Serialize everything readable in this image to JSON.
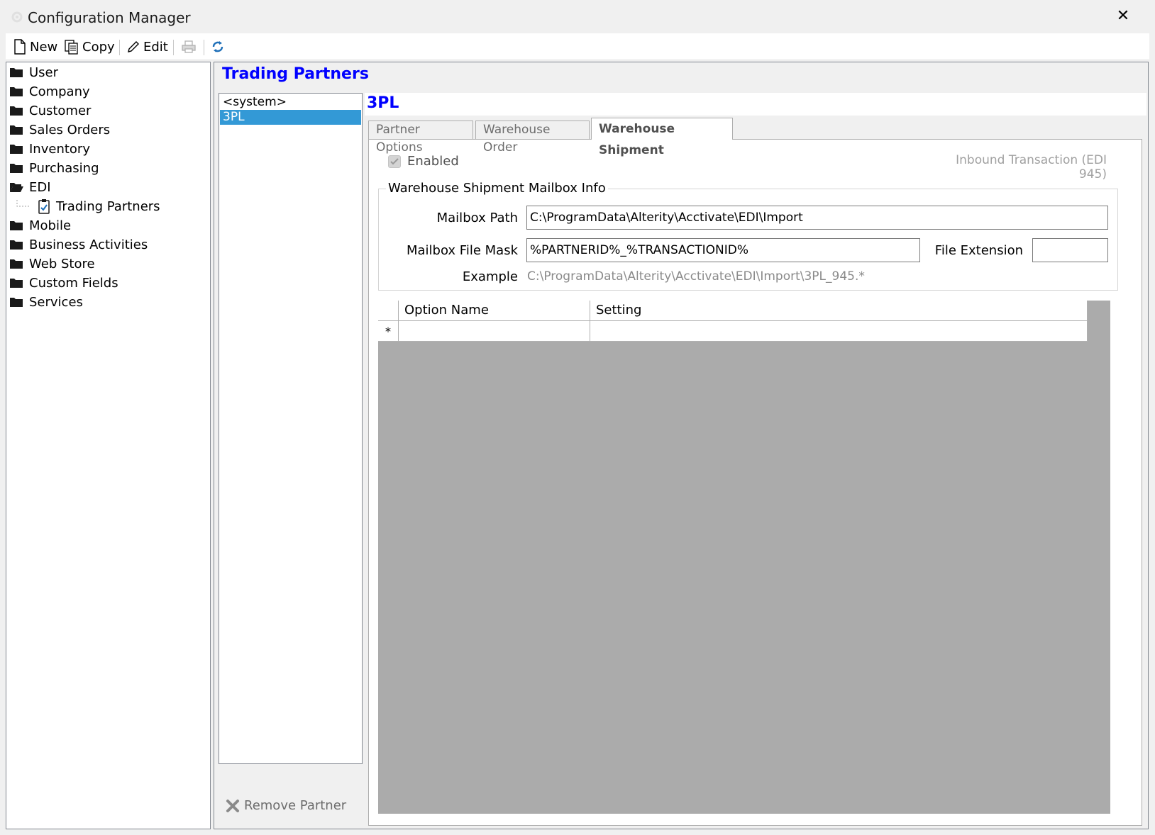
{
  "window": {
    "title": "Configuration Manager",
    "close_glyph": "✕"
  },
  "toolbar": {
    "new_label": "New",
    "copy_label": "Copy",
    "edit_label": "Edit",
    "icons": [
      "new-document-icon",
      "copy-icon",
      "pencil-icon",
      "printer-icon",
      "refresh-icon"
    ]
  },
  "nav": {
    "items": [
      {
        "label": "User",
        "icon": "folder-icon"
      },
      {
        "label": "Company",
        "icon": "folder-icon"
      },
      {
        "label": "Customer",
        "icon": "folder-icon"
      },
      {
        "label": "Sales Orders",
        "icon": "folder-icon"
      },
      {
        "label": "Inventory",
        "icon": "folder-icon"
      },
      {
        "label": "Purchasing",
        "icon": "folder-icon"
      },
      {
        "label": "EDI",
        "icon": "folder-open-icon"
      },
      {
        "label": "Trading Partners",
        "icon": "clipboard-icon"
      },
      {
        "label": "Mobile",
        "icon": "folder-icon"
      },
      {
        "label": "Business Activities",
        "icon": "folder-icon"
      },
      {
        "label": "Web Store",
        "icon": "folder-icon"
      },
      {
        "label": "Custom Fields",
        "icon": "folder-icon"
      },
      {
        "label": "Services",
        "icon": "folder-icon"
      }
    ]
  },
  "main": {
    "title": "Trading Partners",
    "partners": [
      "<system>",
      "3PL"
    ],
    "selected_partner": "3PL",
    "remove_partner_label": "Remove Partner",
    "partner_header": "3PL",
    "tabs": [
      {
        "label": "Partner Options",
        "active": false
      },
      {
        "label": "Warehouse Order",
        "active": false
      },
      {
        "label": "Warehouse Shipment",
        "active": true
      }
    ],
    "shipment": {
      "enabled_label": "Enabled",
      "enabled_checked": true,
      "inbound_label": "Inbound Transaction (EDI 945)",
      "group_title": "Warehouse Shipment Mailbox Info",
      "mailbox_path_label": "Mailbox Path",
      "mailbox_path_value": "C:\\ProgramData\\Alterity\\Acctivate\\EDI\\Import",
      "file_mask_label": "Mailbox File Mask",
      "file_mask_value": "%PARTNERID%_%TRANSACTIONID%",
      "file_extension_label": "File Extension",
      "file_extension_value": "",
      "example_label": "Example",
      "example_value": "C:\\ProgramData\\Alterity\\Acctivate\\EDI\\Import\\3PL_945.*"
    },
    "grid": {
      "columns": [
        "Option Name",
        "Setting"
      ],
      "new_row_marker": "*"
    }
  },
  "colors": {
    "accent_blue": "#0000ff",
    "selection": "#3399d6",
    "grid_background": "#ababab"
  }
}
